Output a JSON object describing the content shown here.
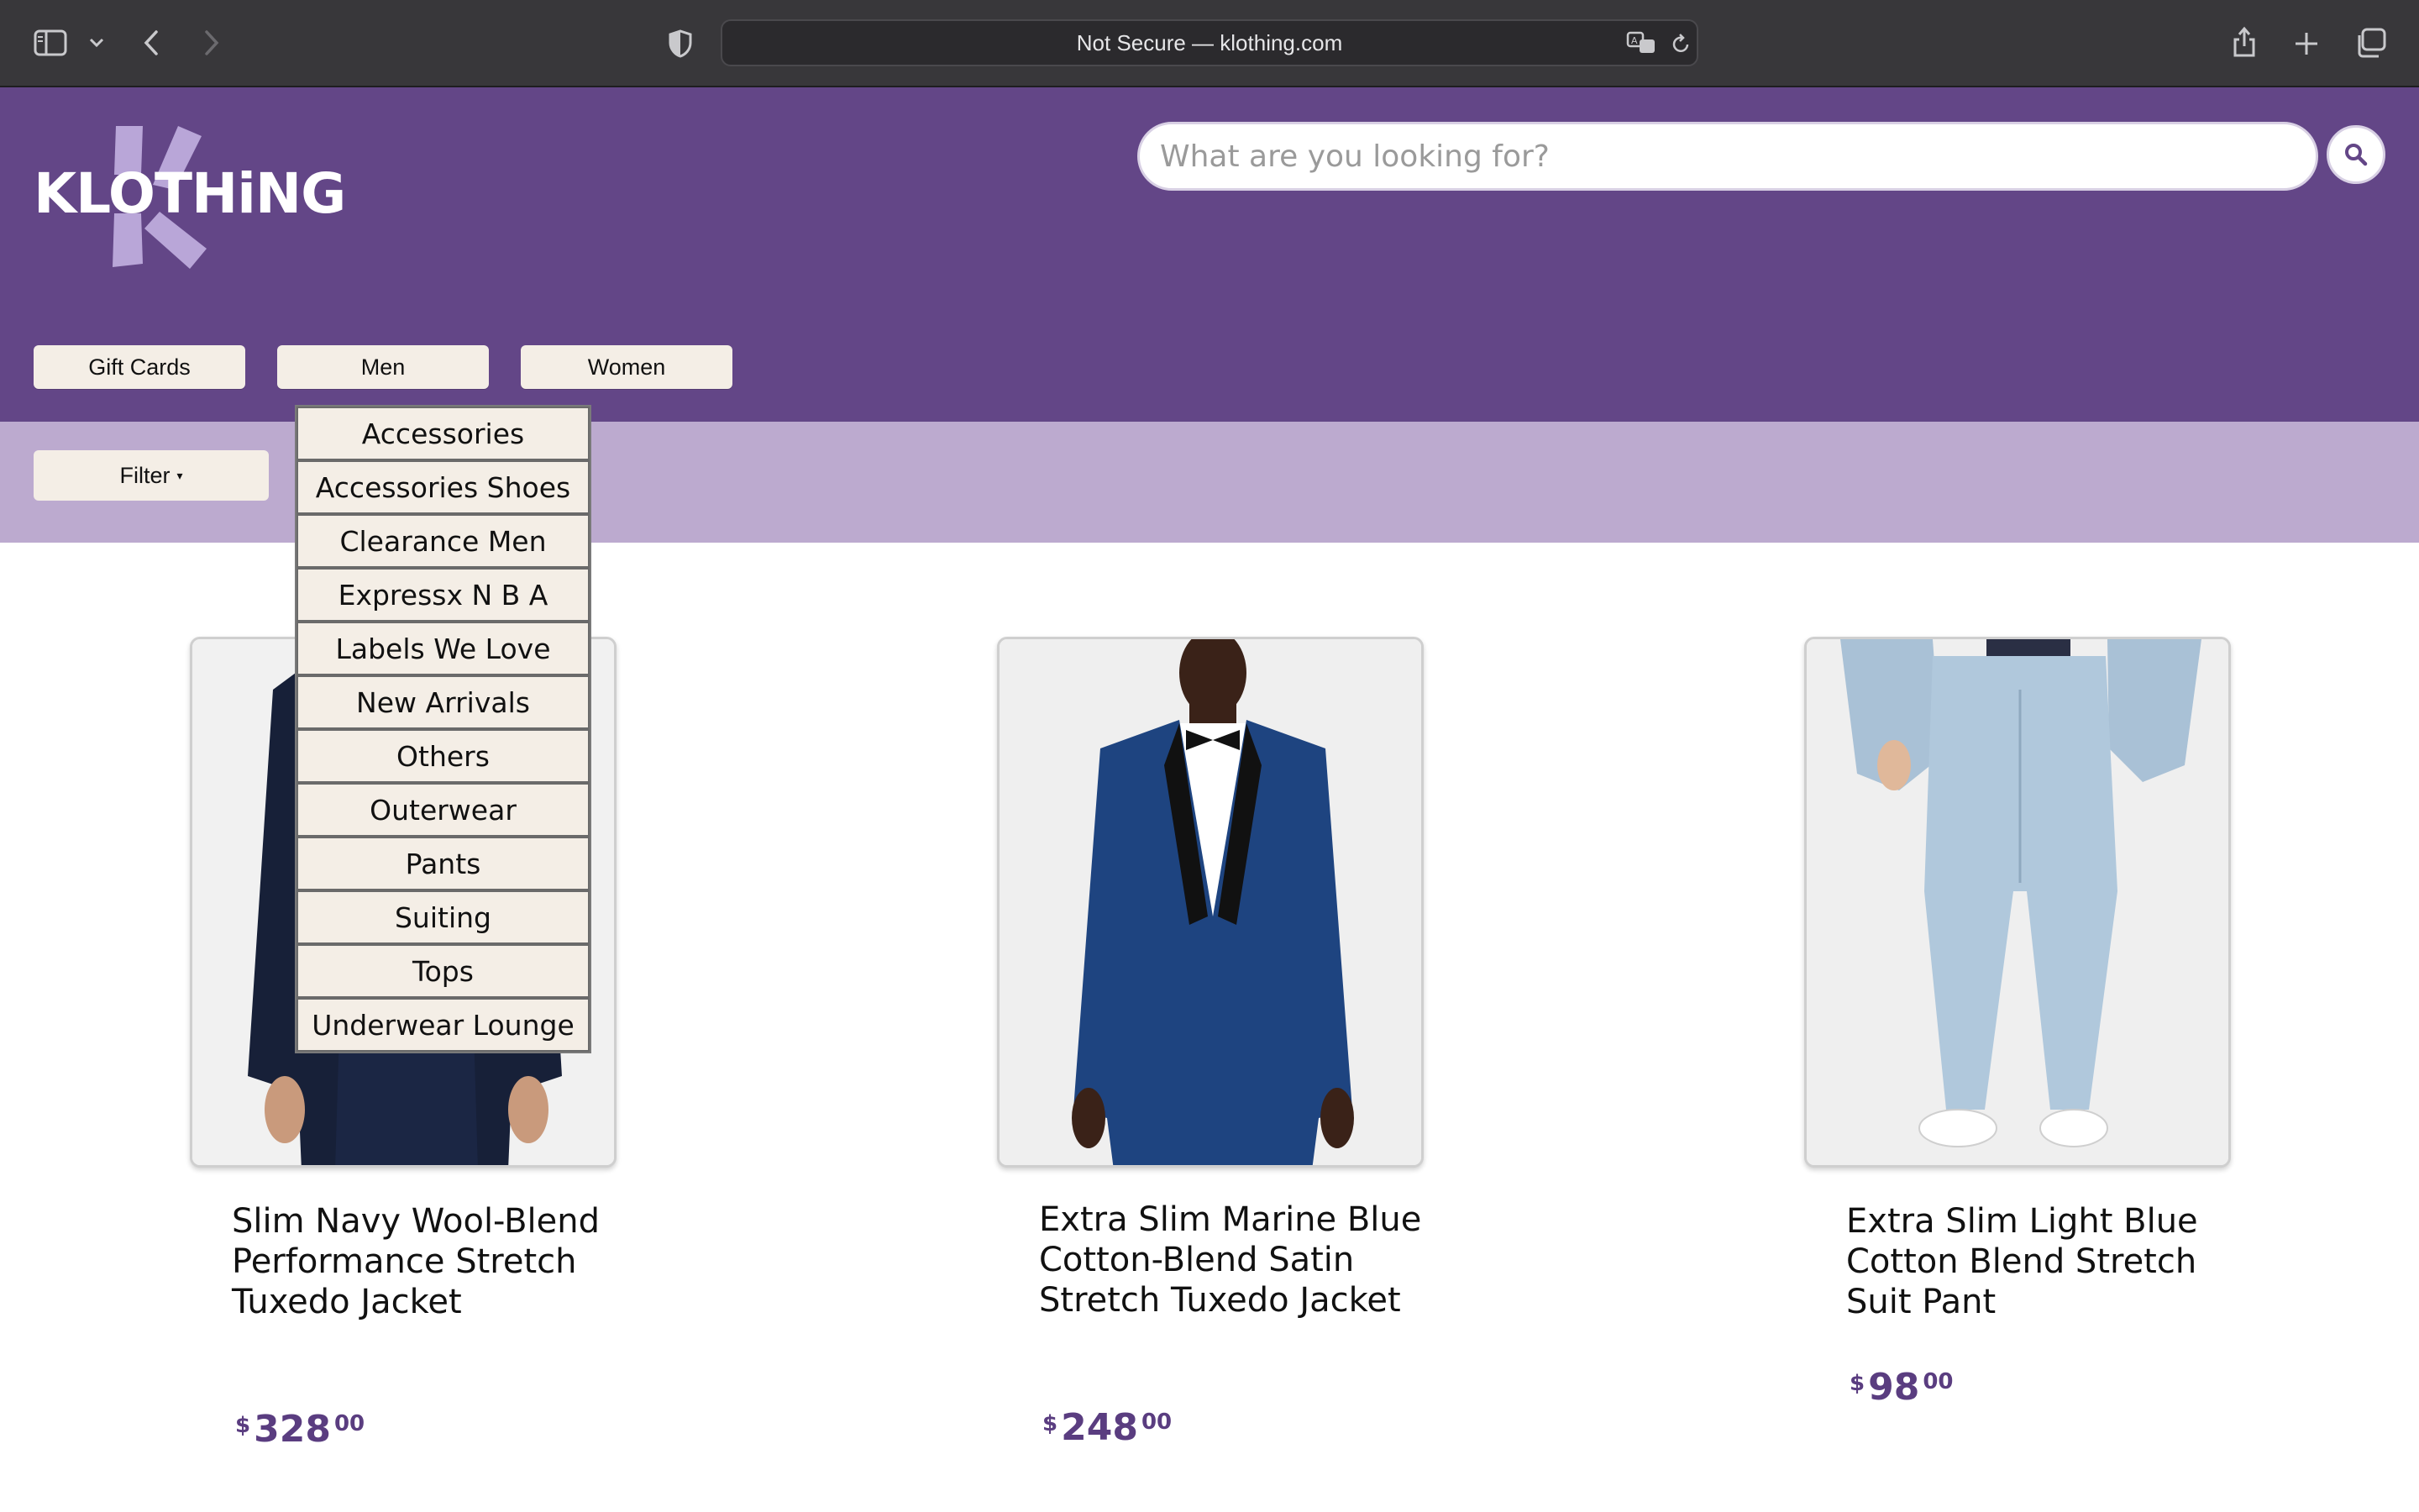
{
  "browser": {
    "url": "Not Secure — klothing.com"
  },
  "site": {
    "logo_text": "KLOTHiNG",
    "brand_color": "#634687",
    "filter_bar_color": "#bcaacf",
    "search": {
      "placeholder": "What are you looking for?"
    }
  },
  "nav": {
    "items": [
      {
        "label": "Gift Cards"
      },
      {
        "label": "Men"
      },
      {
        "label": "Women"
      }
    ]
  },
  "dropdown": {
    "items": [
      "Accessories",
      "Accessories Shoes",
      "Clearance Men",
      "Expressx N B A",
      "Labels We Love",
      "New Arrivals",
      "Others",
      "Outerwear",
      "Pants",
      "Suiting",
      "Tops",
      "Underwear Lounge"
    ]
  },
  "filter": {
    "label": "Filter",
    "caret": "▾"
  },
  "products": [
    {
      "title": "Slim Navy Wool-Blend Performance Stretch Tuxedo Jacket",
      "currency": "$",
      "dollars": "328",
      "cents": "00"
    },
    {
      "title": "Extra Slim Marine Blue Cotton-Blend Satin Stretch Tuxedo Jacket",
      "currency": "$",
      "dollars": "248",
      "cents": "00"
    },
    {
      "title": "Extra Slim Light Blue Cotton Blend Stretch Suit Pant",
      "currency": "$",
      "dollars": "98",
      "cents": "00"
    }
  ]
}
